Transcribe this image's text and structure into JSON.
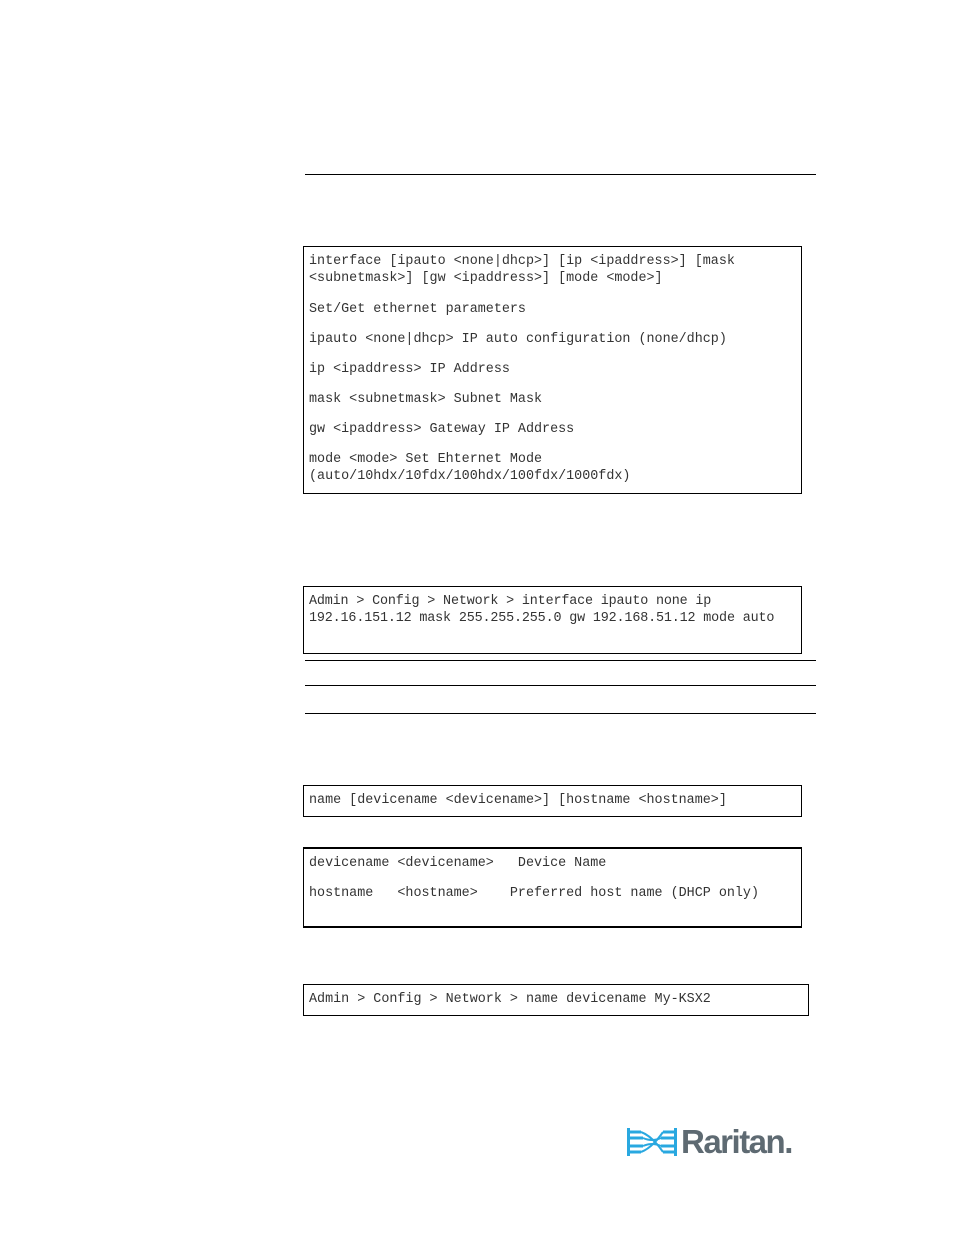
{
  "interface_command": {
    "syntax_lines": [
      "interface [ipauto <none|dhcp>] [ip <ipaddress>] [mask <subnetmask>] [gw <ipaddress>] [mode <mode>]"
    ],
    "description": "Set/Get ethernet parameters",
    "params": [
      "ipauto <none|dhcp> IP auto configuration (none/dhcp)",
      "ip <ipaddress> IP Address",
      "mask <subnetmask> Subnet Mask",
      "gw <ipaddress> Gateway IP Address",
      "mode <mode> Set Ehternet Mode (auto/10hdx/10fdx/100hdx/100fdx/1000fdx)"
    ],
    "example": "Admin > Config > Network > interface ipauto none ip 192.16.151.12 mask 255.255.255.0 gw 192.168.51.12 mode auto"
  },
  "name_command": {
    "syntax": "name [devicename <devicename>] [hostname <hostname>]",
    "params": [
      "devicename <devicename>   Device Name",
      "hostname   <hostname>    Preferred host name (DHCP only)"
    ],
    "example": "Admin > Config > Network > name devicename My-KSX2"
  },
  "footer": {
    "logo_text": "Raritan.",
    "logo_icon": "raritan-logo-icon",
    "logo_color": "#29a8e0"
  }
}
